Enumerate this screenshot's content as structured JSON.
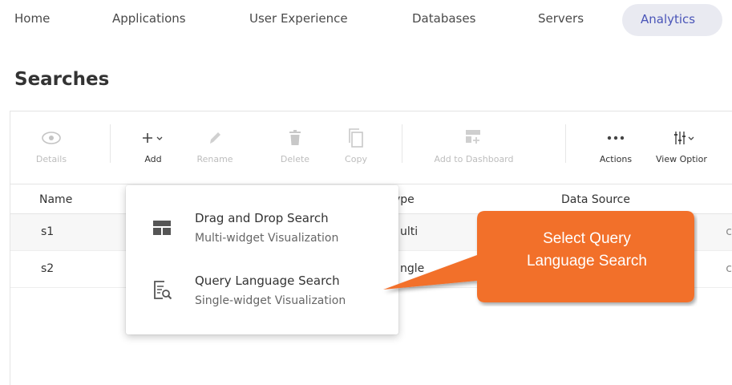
{
  "nav": {
    "items": [
      "Home",
      "Applications",
      "User Experience",
      "Databases",
      "Servers"
    ],
    "active": "Analytics"
  },
  "page": {
    "title": "Searches"
  },
  "toolbar": {
    "details": "Details",
    "add": "Add",
    "rename": "Rename",
    "delete": "Delete",
    "copy": "Copy",
    "add_to_dashboard": "Add to Dashboard",
    "actions": "Actions",
    "view_options": "View Optior"
  },
  "table": {
    "columns": {
      "name": "Name",
      "type": "ype",
      "data_source": "Data Source"
    },
    "rows": [
      {
        "name": "s1",
        "type": "ulti"
      },
      {
        "name": "s2",
        "type": "ngle"
      }
    ],
    "edge": "c"
  },
  "dropdown": {
    "items": [
      {
        "title": "Drag and Drop Search",
        "subtitle": "Multi-widget Visualization"
      },
      {
        "title": "Query Language Search",
        "subtitle": "Single-widget Visualization"
      }
    ]
  },
  "callout": {
    "line1": "Select Query",
    "line2": "Language Search"
  },
  "colors": {
    "accent": "#4a55b8",
    "callout": "#f26f2b",
    "active_bg": "#e9eaf1"
  }
}
